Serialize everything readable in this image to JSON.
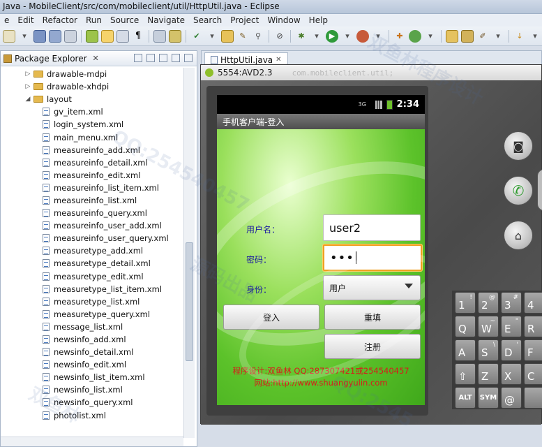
{
  "window": {
    "title": "Java - MobileClient/src/com/mobileclient/util/HttpUtil.java - Eclipse"
  },
  "menu": [
    "e",
    "Edit",
    "Refactor",
    "Run",
    "Source",
    "Navigate",
    "Search",
    "Project",
    "Window",
    "Help"
  ],
  "package_explorer": {
    "title": "Package Explorer",
    "tree": [
      {
        "label": "drawable-mdpi",
        "kind": "folder",
        "expanded": false,
        "depth": 1
      },
      {
        "label": "drawable-xhdpi",
        "kind": "folder",
        "expanded": false,
        "depth": 1
      },
      {
        "label": "layout",
        "kind": "folder",
        "expanded": true,
        "depth": 1
      },
      {
        "label": "gv_item.xml",
        "kind": "file",
        "depth": 2
      },
      {
        "label": "login_system.xml",
        "kind": "file",
        "depth": 2
      },
      {
        "label": "main_menu.xml",
        "kind": "file",
        "depth": 2
      },
      {
        "label": "measureinfo_add.xml",
        "kind": "file",
        "depth": 2
      },
      {
        "label": "measureinfo_detail.xml",
        "kind": "file",
        "depth": 2
      },
      {
        "label": "measureinfo_edit.xml",
        "kind": "file",
        "depth": 2
      },
      {
        "label": "measureinfo_list_item.xml",
        "kind": "file",
        "depth": 2
      },
      {
        "label": "measureinfo_list.xml",
        "kind": "file",
        "depth": 2
      },
      {
        "label": "measureinfo_query.xml",
        "kind": "file",
        "depth": 2
      },
      {
        "label": "measureinfo_user_add.xml",
        "kind": "file",
        "depth": 2
      },
      {
        "label": "measureinfo_user_query.xml",
        "kind": "file",
        "depth": 2
      },
      {
        "label": "measuretype_add.xml",
        "kind": "file",
        "depth": 2
      },
      {
        "label": "measuretype_detail.xml",
        "kind": "file",
        "depth": 2
      },
      {
        "label": "measuretype_edit.xml",
        "kind": "file",
        "depth": 2
      },
      {
        "label": "measuretype_list_item.xml",
        "kind": "file",
        "depth": 2
      },
      {
        "label": "measuretype_list.xml",
        "kind": "file",
        "depth": 2
      },
      {
        "label": "measuretype_query.xml",
        "kind": "file",
        "depth": 2
      },
      {
        "label": "message_list.xml",
        "kind": "file",
        "depth": 2
      },
      {
        "label": "newsinfo_add.xml",
        "kind": "file",
        "depth": 2
      },
      {
        "label": "newsinfo_detail.xml",
        "kind": "file",
        "depth": 2
      },
      {
        "label": "newsinfo_edit.xml",
        "kind": "file",
        "depth": 2
      },
      {
        "label": "newsinfo_list_item.xml",
        "kind": "file",
        "depth": 2
      },
      {
        "label": "newsinfo_list.xml",
        "kind": "file",
        "depth": 2
      },
      {
        "label": "newsinfo_query.xml",
        "kind": "file",
        "depth": 2
      },
      {
        "label": "photolist.xml",
        "kind": "file",
        "depth": 2
      }
    ]
  },
  "editor": {
    "tab_label": "HttpUtil.java",
    "code_hint": "com.mobileclient.util;"
  },
  "emulator": {
    "title": "5554:AVD2.3",
    "status_clock": "2:34",
    "app_title": "手机客户端-登入",
    "username_label": "用户名：",
    "username_value": "user2",
    "password_label": "密码：",
    "password_value": "•••",
    "identity_label": "身份：",
    "identity_value": "用户",
    "login_button": "登入",
    "reset_button": "重填",
    "register_button": "注册",
    "credit_line1": "程序设计:双鱼林    QQ:287307421或254540457",
    "credit_line2": "网站:http://www.shuangyulin.com"
  },
  "keyboard": {
    "row1": [
      {
        "main": "1",
        "alt": "!"
      },
      {
        "main": "2",
        "alt": "@"
      },
      {
        "main": "3",
        "alt": "#"
      },
      {
        "main": "4",
        "alt": ""
      }
    ],
    "row2": [
      {
        "main": "Q",
        "alt": ""
      },
      {
        "main": "W",
        "alt": "~"
      },
      {
        "main": "E",
        "alt": "\""
      },
      {
        "main": "R",
        "alt": ""
      }
    ],
    "row3": [
      {
        "main": "A",
        "alt": ""
      },
      {
        "main": "S",
        "alt": "\\"
      },
      {
        "main": "D",
        "alt": "'"
      },
      {
        "main": "F",
        "alt": ""
      }
    ],
    "row4": [
      {
        "main": "⇧",
        "alt": ""
      },
      {
        "main": "Z",
        "alt": ""
      },
      {
        "main": "X",
        "alt": ""
      },
      {
        "main": "C",
        "alt": ""
      }
    ],
    "row5": [
      {
        "main": "ALT",
        "alt": ""
      },
      {
        "main": "SYM",
        "alt": ""
      },
      {
        "main": "@",
        "alt": ""
      },
      {
        "main": "",
        "alt": ""
      }
    ]
  },
  "watermarks": [
    "QQ:254540457",
    "双鱼林程序设计",
    "源码出品",
    "双鱼林",
    "QQ:2545"
  ]
}
